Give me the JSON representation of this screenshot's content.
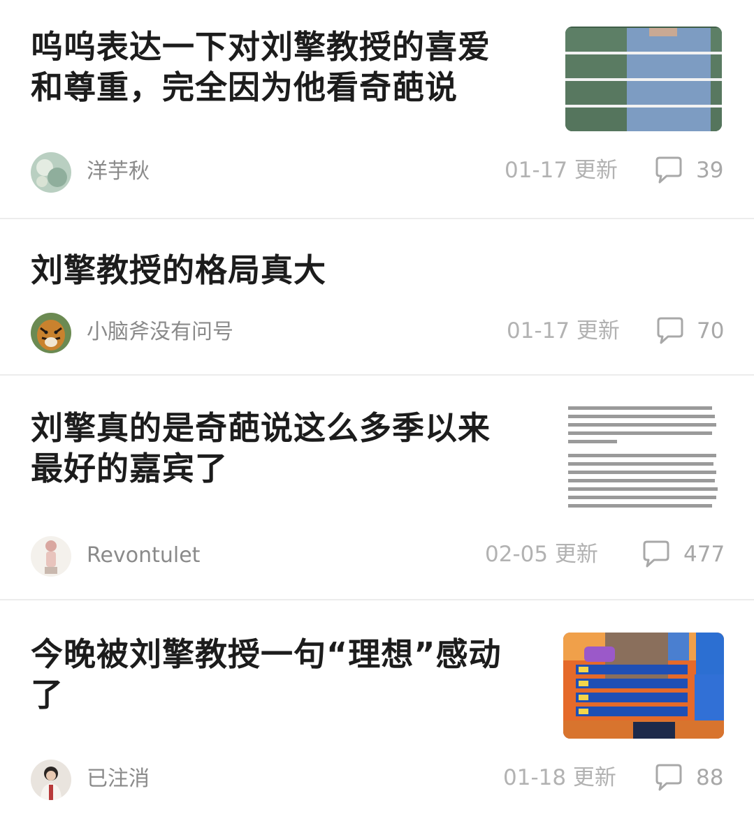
{
  "posts": [
    {
      "title_line1": "呜呜表达一下对刘擎教授的喜爱",
      "title_line2": "和尊重，完全因为他看奇葩说",
      "author": "洋芋秋",
      "date": "01-17 更新",
      "comments": "39"
    },
    {
      "title_line1": "刘擎教授的格局真大",
      "author": "小脑斧没有问号",
      "date": "01-17 更新",
      "comments": "70"
    },
    {
      "title_line1": "刘擎真的是奇葩说这么多季以来",
      "title_line2": "最好的嘉宾了",
      "author": "Revontulet",
      "date": "02-05 更新",
      "comments": "477"
    },
    {
      "title_line1": "今晚被刘擎教授一句“理想”感动",
      "title_line2": "了",
      "author": "已注消",
      "date": "01-18 更新",
      "comments": "88"
    }
  ],
  "colors": {
    "title": "#1c1c1c",
    "meta": "#b2b2b2",
    "divider": "#ececec"
  },
  "icons": {
    "comment": "speech-bubble-icon"
  }
}
